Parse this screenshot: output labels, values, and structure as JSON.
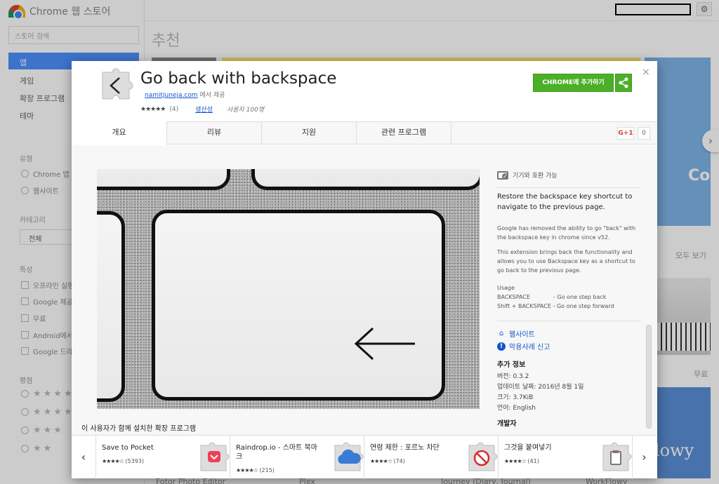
{
  "store": {
    "name": "Chrome 웹 스토어",
    "search_placeholder": "스토어 검색",
    "nav": [
      "앱",
      "게임",
      "확장 프로그램",
      "테마"
    ],
    "type_section": "유형",
    "type_options": [
      "Chrome 앱",
      "웹사이트"
    ],
    "category_section": "카테고리",
    "category_value": "전체",
    "features_section": "특성",
    "features": [
      "오프라인 실행",
      "Google 제공",
      "무료",
      "Android에서",
      "Google 드라이브"
    ],
    "rating_section": "평점",
    "page_heading": "추천",
    "see_all": "모두 보기",
    "free": "무료",
    "tile_text_co": "Co",
    "tile_text_flowy": "lowy",
    "tile_text_o": "o",
    "bottom_labels": [
      "Fotor Photo Editor",
      "Plex",
      "Journey (Diary, Journal)",
      "WorkFlowy"
    ]
  },
  "extension": {
    "title": "Go back with backspace",
    "publisher": "namitjuneja.com",
    "publisher_suffix": "에서 제공",
    "stars": "★★★★★",
    "rating_count": "(4)",
    "category": "생산성",
    "users": "사용자 100명",
    "add_button": "CHROME에 추가하기",
    "close": "×"
  },
  "tabs": [
    "개요",
    "리뷰",
    "지원",
    "관련 프로그램"
  ],
  "social": {
    "gplus": "G+1",
    "count": "0"
  },
  "details": {
    "compat": "기기와 호환 가능",
    "summary": "Restore the backspace key shortcut to navigate to the previous page.",
    "desc1": "Google has removed the ability to go \"back\" with the backspace key in chrome since v52.",
    "desc2": "This extension brings back the functionality and allows you to use Backspace key as a shortcut to go back to the previous page.",
    "usage_title": "Usage",
    "usage1": "BACKSPACE             - Go one step back",
    "usage2": "Shift + BACKSPACE - Go one step forward",
    "website": "웹사이트",
    "report": "악용사례 신고",
    "info_title": "추가 정보",
    "version": "버전: 0.3.2",
    "updated": "업데이트 날짜: 2016년 8월 1일",
    "size": "크기: 3.7KiB",
    "language": "언어: English",
    "developer": "개발자"
  },
  "related": {
    "title": "이 사용자가 함께 설치한 확장 프로그램",
    "items": [
      {
        "name": "Save to Pocket",
        "stars": "★★★★☆",
        "count": "(5393)",
        "icon": "pocket-icon",
        "color": "#ee4056"
      },
      {
        "name": "Raindrop.io - 스마트 북마크",
        "stars": "★★★★☆",
        "count": "(215)",
        "icon": "cloud-icon",
        "color": "#3a7bd5"
      },
      {
        "name": "연령 제한 : 포르노 차단",
        "stars": "★★★★☆",
        "count": "(74)",
        "icon": "block-icon",
        "color": "#d32f2f"
      },
      {
        "name": "그것을 붙여넣기",
        "stars": "★★★★☆",
        "count": "(41)",
        "icon": "clipboard-icon",
        "color": "#555555"
      }
    ]
  },
  "colors": {
    "accent_green": "#4caf28",
    "link_blue": "#1155cc",
    "nav_active": "#4d90fe"
  }
}
